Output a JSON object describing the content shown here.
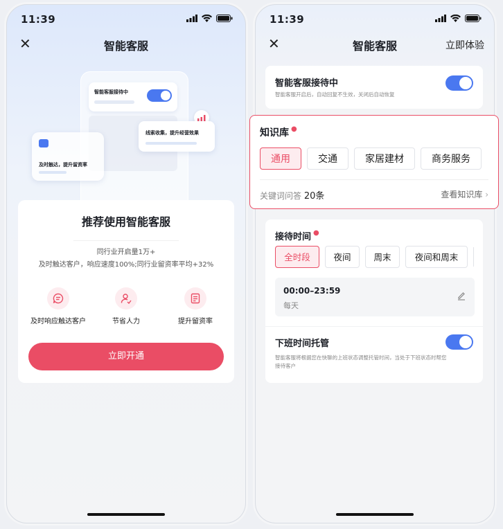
{
  "status": {
    "time": "11:39"
  },
  "left_screen": {
    "nav": {
      "title": "智能客服"
    },
    "illustration": {
      "card_reception": "智能客服接待中",
      "card_leads": "线索收集，提升经营效果",
      "card_reach": "及时触达，提升留资率"
    },
    "recommend": {
      "title": "推荐使用智能客服",
      "line1": "同行业开启量1万+",
      "line2": "及时触达客户，响应速度100%;同行业留资率平均+32%",
      "features": [
        {
          "label": "及时响应触达客户",
          "icon": "chat-icon"
        },
        {
          "label": "节省人力",
          "icon": "user-check-icon"
        },
        {
          "label": "提升留资率",
          "icon": "form-icon"
        }
      ],
      "open_button": "立即开通"
    }
  },
  "right_screen": {
    "nav": {
      "title": "智能客服",
      "action": "立即体验"
    },
    "reception": {
      "title": "智能客服接待中",
      "desc": "智能客服开启后，自动回复不生效，关闭后自动恢复",
      "enabled": true
    },
    "knowledge_base": {
      "title": "知识库",
      "tags": [
        "通用",
        "交通",
        "家居建材",
        "商务服务"
      ],
      "selected": "通用",
      "keyword_label": "关键词问答",
      "keyword_count": "20条",
      "view_link": "查看知识库"
    },
    "reception_time": {
      "title": "接待时间",
      "tags": [
        "全时段",
        "夜间",
        "周末",
        "夜间和周末"
      ],
      "selected": "全时段",
      "range": "00:00–23:59",
      "range_sub": "每天"
    },
    "off_duty": {
      "title": "下班时间托管",
      "desc": "智能客服将根据您在快聊的上班状态调整托管时间，当处于下班状态时帮您接待客户",
      "enabled": true
    }
  },
  "colors": {
    "accent": "#ea4d65",
    "toggle": "#4a78f0"
  }
}
